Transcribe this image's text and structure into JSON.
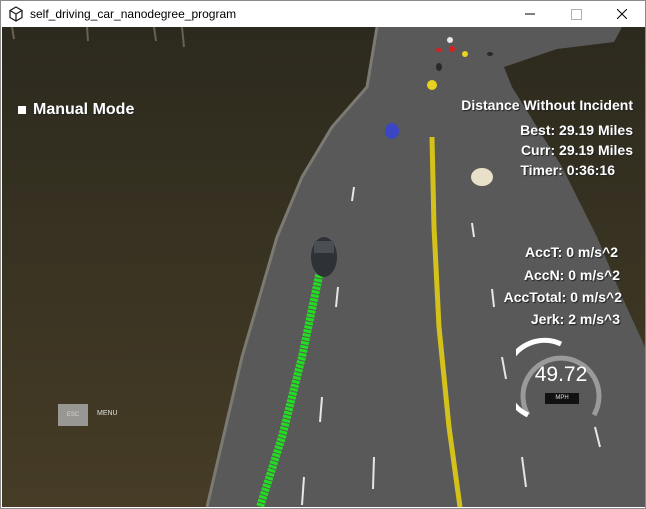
{
  "window": {
    "title": "self_driving_car_nanodegree_program",
    "icon": "unity-icon",
    "minimize_icon": "minimize-icon",
    "maximize_icon": "maximize-icon",
    "close_icon": "close-icon"
  },
  "hud": {
    "mode": "Manual Mode",
    "heading": "Distance Without Incident",
    "best": "Best: 29.19 Miles",
    "curr": "Curr: 29.19 Miles",
    "timer": "Timer: 0:36:16",
    "acc_t": "AccT: 0 m/s^2",
    "acc_n": "AccN: 0 m/s^2",
    "acc_total": "AccTotal: 0 m/s^2",
    "jerk": "Jerk: 2 m/s^3"
  },
  "menu": {
    "esc_label": "ESC",
    "label": "MENU"
  },
  "speedometer": {
    "value": "49.72",
    "unit": "MPH"
  },
  "colors": {
    "terrain": "#3a3424",
    "road": "#595959",
    "path": "#22dd22",
    "lane_yellow": "#d4c21a",
    "hud_text": "#ffffff"
  }
}
